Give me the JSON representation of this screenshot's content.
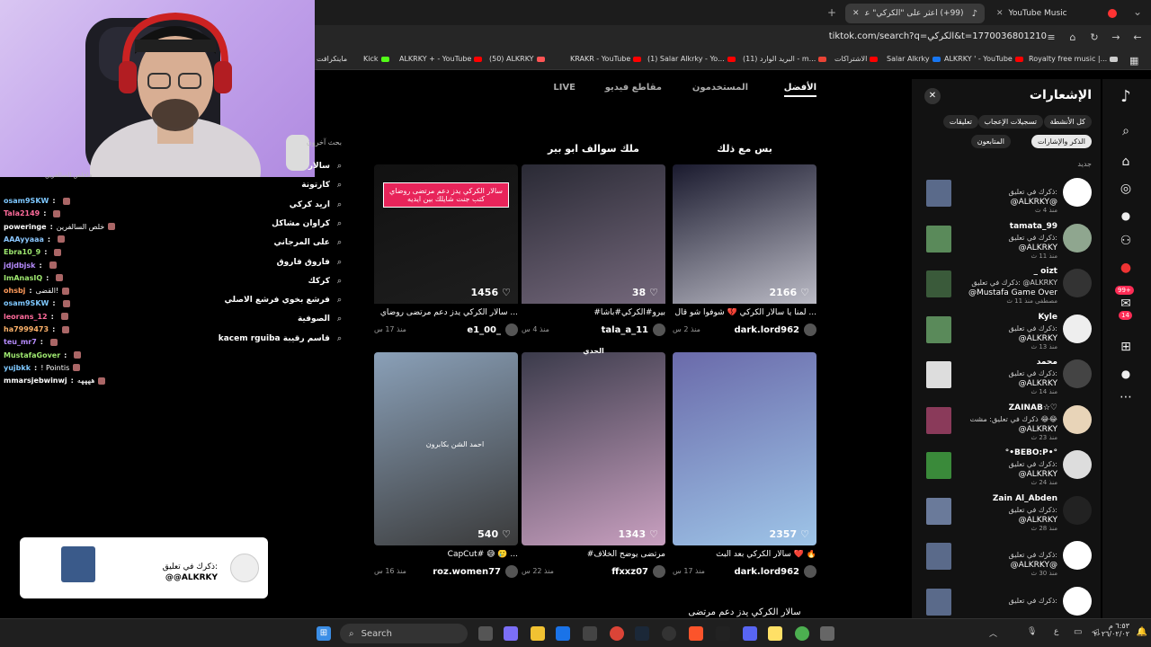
{
  "browser": {
    "tabs": [
      {
        "label": "YouTube Music",
        "active": false
      },
      {
        "label": "(99+) اعثر على \"الكركي\" على TikTok",
        "active": true
      }
    ],
    "url": "tiktok.com/search?q=الكركي&t=1770036801210",
    "bookmarks": [
      {
        "label": "ماينكرافت",
        "color": "#4caf50"
      },
      {
        "label": "Kick",
        "color": "#53fc18"
      },
      {
        "label": "ALKRKY + - YouTube",
        "color": "#ff0000"
      },
      {
        "label": "(50) ALKRKY",
        "color": "#ff5555"
      },
      {
        "label": "KRAKR - YouTube",
        "color": "#ff0000"
      },
      {
        "label": "(1) Salar Alkrky - Yo...",
        "color": "#ff0000"
      },
      {
        "label": "(11) البريد الوارد - m...",
        "color": "#ea4335"
      },
      {
        "label": "الاشتراكات",
        "color": "#ff0000"
      },
      {
        "label": "Salar Alkrky",
        "color": "#1877f2"
      },
      {
        "label": "ALKRKY ' - YouTube",
        "color": "#ff0000"
      },
      {
        "label": "Royalty free music |...",
        "color": "#888888"
      }
    ]
  },
  "chat": {
    "header_partial": "ماخلص السالفرين",
    "lines": [
      {
        "user": "osam9SKW",
        "msg": "",
        "color": "#7ec8ff"
      },
      {
        "user": "Tala2149",
        "msg": "",
        "color": "#ff6b9b"
      },
      {
        "user": "poweringe",
        "msg": "خلص السالفرين",
        "color": "#ffffff"
      },
      {
        "user": "AAAyyaaa",
        "msg": "",
        "color": "#8ac7ff"
      },
      {
        "user": "Ebra10_9",
        "msg": "",
        "color": "#9fe870"
      },
      {
        "user": "jdjdbjsk",
        "msg": "",
        "color": "#b78cff"
      },
      {
        "user": "ImAnasIQ",
        "msg": "",
        "color": "#9fe870"
      },
      {
        "user": "ohsbj",
        "msg": "القضى!",
        "color": "#ff9a5a"
      },
      {
        "user": "osam9SKW",
        "msg": "",
        "color": "#7ec8ff"
      },
      {
        "user": "leorans_12",
        "msg": "",
        "color": "#ff6b9b"
      },
      {
        "user": "ha7999473",
        "msg": "",
        "color": "#ffb36b"
      },
      {
        "user": "teu_mr7",
        "msg": "",
        "color": "#b78cff"
      },
      {
        "user": "MustafaGover",
        "msg": "",
        "color": "#9fe870"
      },
      {
        "user": "yujbkk",
        "msg": "! Pointis",
        "color": "#7ec8ff"
      },
      {
        "user": "mmarsjebwinwj",
        "msg": "ههههه",
        "color": "#ffffff"
      }
    ]
  },
  "search": {
    "more_label": "بحث آخرون",
    "suggestions": [
      "سالار",
      "كارتونة",
      "اريد كركي",
      "كراوان مشاكل",
      "على المرجاني",
      "فاروق فاروق",
      "كركك",
      "فرشع بخوي فرشع الاصلي",
      "الصوفية",
      "kacem rguiba قاسم رقيبة"
    ]
  },
  "tiktok": {
    "tabs": [
      {
        "label": "الأفضل",
        "active": true
      },
      {
        "label": "المستخدمون",
        "active": false
      },
      {
        "label": "مقاطع فيديو",
        "active": false
      },
      {
        "label": "LIVE",
        "active": false
      }
    ],
    "videos": [
      {
        "title": "بس مع ذلك",
        "likes": "2166",
        "caption": "لمنا يا سالار الكركي 💔 شوفوا شو قال ...",
        "user": "dark.lord962",
        "time": "منذ 2 س"
      },
      {
        "title": "ملك سوالف ابو بير",
        "likes": "38",
        "caption": "#بيرو#الكركي#باشا",
        "user": "tala_a_11",
        "time": "منذ 4 س"
      },
      {
        "title": "",
        "overlay": "سالار الكركي يدز دعم مرتضى روضاي كتب جنت شايلك بين ايديه",
        "likes": "1456",
        "caption": "سالار الكركي يدز دعم مرتضى روضاي ...",
        "user": "e1_00_",
        "time": "منذ 17 س"
      },
      {
        "title": "",
        "likes": "2357",
        "caption": "سالار الكركي بعد البث ❤️ 🔥",
        "user": "dark.lord962",
        "time": "منذ 17 س"
      },
      {
        "title": "الحدي",
        "likes": "1343",
        "caption": "#مرتضى يوضح الخلاف",
        "user": "ffxxz07",
        "time": "منذ 22 س"
      },
      {
        "title": "",
        "overlay": "احمد الشن بكابرون",
        "likes": "540",
        "caption": "CapCut# 😅 🥲 ...",
        "user": "roz.women77",
        "time": "منذ 16 س"
      }
    ],
    "bottom_caption": "سالار الكركي يدز دعم مرتضى"
  },
  "notifications": {
    "title": "الإشعارات",
    "filters": [
      "كل الأنشطة",
      "تسجيلات الإعجاب",
      "تعليقات",
      "الذكر والإشارات",
      "المتابعون"
    ],
    "active_filter": "الذكر والإشارات",
    "section": "جديد",
    "items": [
      {
        "name": "",
        "text": "ذكرك في تعليق:",
        "sub": "@ALKRKY@",
        "time": "منذ 4 ث"
      },
      {
        "name": "tamata_99",
        "text": "ذكرك في تعليق:",
        "sub": "@ALKRKY",
        "time": "منذ 11 ث"
      },
      {
        "name": "_ oizt",
        "text": "ذكرك في تعليق: @ALKRKY",
        "sub": "@Mustafa Game Over",
        "time": "مصطفى منذ 11 ث"
      },
      {
        "name": "Kyle",
        "text": "ذكرك في تعليق:",
        "sub": "@ALKRKY",
        "time": "منذ 13 ث"
      },
      {
        "name": "محمد",
        "text": "ذكرك في تعليق:",
        "sub": "@ALKRKY",
        "time": "منذ 14 ث"
      },
      {
        "name": "ZAINAB☆♡",
        "text": "ذكرك في تعليق: مشت 😂😂",
        "sub": "@ALKRKY",
        "time": "منذ 23 ث"
      },
      {
        "name": "°•BEBO:P•°",
        "text": "ذكرك في تعليق:",
        "sub": "@ALKRKY",
        "time": "منذ 24 ث"
      },
      {
        "name": "Zain Al_Abden",
        "text": "ذكرك في تعليق:",
        "sub": "@ALKRKY",
        "time": "منذ 28 ث"
      },
      {
        "name": "",
        "text": "ذكرك في تعليق:",
        "sub": "@ALKRKY@",
        "time": "منذ 30 ث"
      },
      {
        "name": "",
        "text": "ذكرك في تعليق:",
        "sub": "",
        "time": ""
      }
    ]
  },
  "rightnav": {
    "badges": [
      "99+",
      "14"
    ]
  },
  "toast": {
    "text": "ذكرك في تعليق:",
    "sub": "@@ALKRKY",
    "close": "✕"
  },
  "taskbar": {
    "search_label": "Search",
    "time": "٦:٥٣ م",
    "date": "٢٠٢٦/٠٢/٠٢",
    "lang": "ع"
  }
}
